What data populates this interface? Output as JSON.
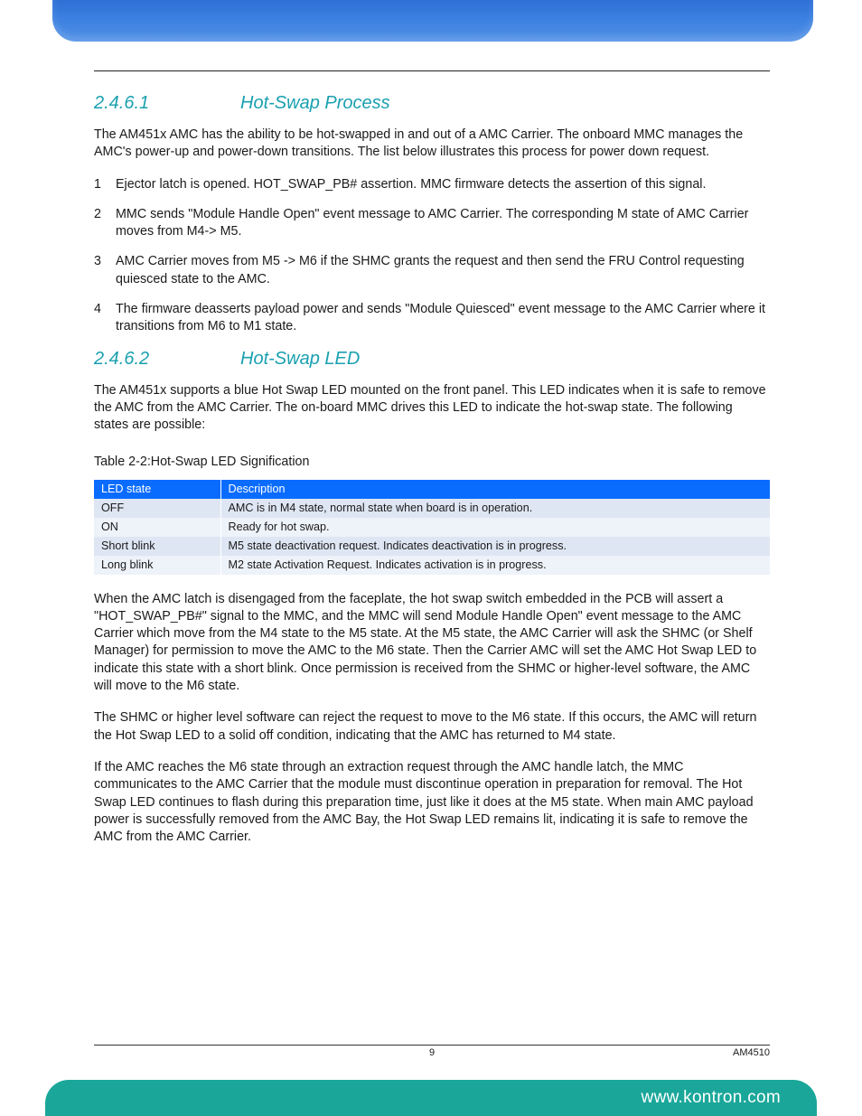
{
  "sections": [
    {
      "number": "2.4.6.1",
      "title": "Hot-Swap Process",
      "intro": "The AM451x AMC has the ability to be hot-swapped in and out of a AMC Carrier. The onboard MMC manages the AMC's power-up and power-down transitions. The list below illustrates this process for power down request.",
      "steps": [
        "Ejector latch is opened. HOT_SWAP_PB# assertion. MMC firmware detects the assertion of this signal.",
        "MMC sends \"Module Handle Open\" event message to AMC Carrier. The corresponding M state of AMC Carrier moves from M4-> M5.",
        "AMC Carrier moves from M5 -> M6 if the SHMC grants the request and then send the FRU Control requesting quiesced state to the AMC.",
        "The firmware deasserts payload power and sends \"Module Quiesced\" event message to the AMC Carrier where it transitions from M6 to M1 state."
      ]
    },
    {
      "number": "2.4.6.2",
      "title": "Hot-Swap LED",
      "intro": "The AM451x supports a blue Hot Swap LED mounted on the front panel. This LED indicates when it is safe to remove the AMC from the AMC Carrier. The on-board MMC drives this LED to indicate the hot-swap state. The following states are possible:"
    }
  ],
  "table": {
    "caption": "Table 2-2:Hot-Swap LED Signification",
    "headers": [
      "LED state",
      "Description"
    ],
    "rows": [
      [
        "OFF",
        "AMC is in M4 state, normal state when board is in operation."
      ],
      [
        "ON",
        "Ready for hot swap."
      ],
      [
        "Short blink",
        "M5 state deactivation request. Indicates deactivation is in progress."
      ],
      [
        "Long blink",
        "M2 state Activation Request. Indicates activation is in progress."
      ]
    ]
  },
  "after_table_paragraphs": [
    "When the AMC latch is disengaged from the faceplate, the hot swap switch embedded in the PCB will assert a \"HOT_SWAP_PB#\" signal to the MMC, and the MMC will send Module Handle Open\" event message to the AMC Carrier which move from the M4 state to the M5 state. At the M5 state, the AMC Carrier will ask the SHMC (or Shelf Manager) for permission to move the AMC to the M6 state. Then the Carrier AMC will set the AMC Hot Swap LED to indicate this state with a short blink. Once permission is received from the SHMC or higher-level software, the AMC will move to the M6 state.",
    "The SHMC or higher level software can reject the request to move to the M6 state. If this occurs, the AMC will return the Hot Swap LED to a solid off condition, indicating that the AMC has returned to M4 state.",
    "If the AMC reaches the M6 state through an extraction request through the AMC handle latch, the MMC communicates to the AMC Carrier that the module must discontinue operation in preparation for removal. The Hot Swap LED continues to flash during this preparation time, just like it does at the M5 state. When main AMC payload power is successfully removed from the AMC Bay, the Hot Swap LED remains lit, indicating it is safe to remove the AMC from the AMC Carrier."
  ],
  "footer": {
    "page_number": "9",
    "doc_id": "AM4510",
    "url": "www.kontron.com"
  }
}
